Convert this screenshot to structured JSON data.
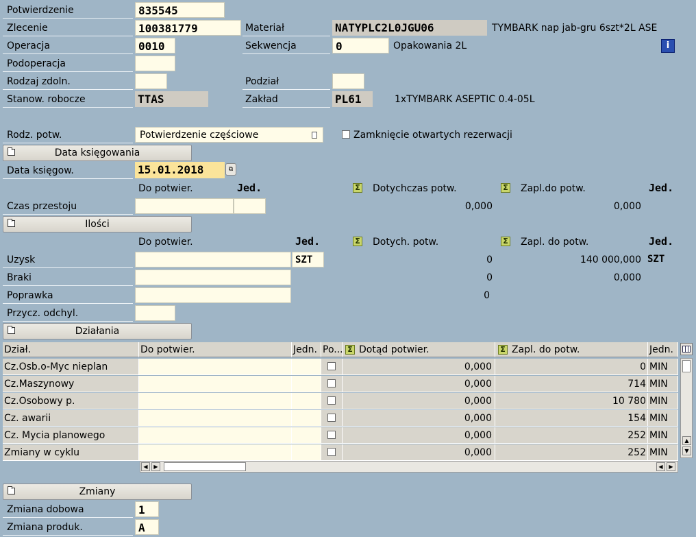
{
  "header": {
    "potwierdzenie_label": "Potwierdzenie",
    "potwierdzenie_value": "835545",
    "zlecenie_label": "Zlecenie",
    "zlecenie_value": "100381779",
    "material_label": "Materiał",
    "material_value": "NATYPLC2L0JGU06",
    "material_desc": "TYMBARK nap jab-gru 6szt*2L ASE",
    "operacja_label": "Operacja",
    "operacja_value": "0010",
    "sekwencja_label": "Sekwencja",
    "sekwencja_value": "0",
    "sekwencja_desc": "Opakowania 2L",
    "podoperacja_label": "Podoperacja",
    "rodzaj_label": "Rodzaj zdoln.",
    "podzial_label": "Podział",
    "stanow_label": "Stanow. robocze",
    "stanow_value": "TTAS",
    "zaklad_label": "Zakład",
    "zaklad_value": "PL61",
    "zaklad_desc": "1xTYMBARK ASEPTIC 0.4-05L",
    "info_icon": "i"
  },
  "rodz": {
    "label": "Rodz. potw.",
    "value": "Potwierdzenie częściowe",
    "zamkniecie_label": "Zamknięcie otwartych rezerwacji"
  },
  "data_ksieg": {
    "section_button": "Data księgowania",
    "label": "Data księgow.",
    "value": "15.01.2018",
    "col_do_potwier": "Do potwier.",
    "col_jed": "Jed.",
    "col_dotychczas": "Dotychczas potw.",
    "col_zapl": "Zapl.do potw.",
    "col_jed2": "Jed.",
    "czas_label": "Czas przestoju",
    "czas_dotychczas": "0,000",
    "czas_zapl": "0,000"
  },
  "ilosci": {
    "section_button": "Ilości",
    "col_do_potwier": "Do potwier.",
    "col_jed": "Jed.",
    "col_dotych": "Dotych. potw.",
    "col_zapl": "Zapl. do potw.",
    "col_jed2": "Jed.",
    "uzysk_label": "Uzysk",
    "uzysk_unit": "SZT",
    "uzysk_dotych": "0",
    "uzysk_zapl": "140 000,000",
    "uzysk_unit2": "SZT",
    "braki_label": "Braki",
    "braki_dotych": "0",
    "braki_zapl": "0,000",
    "poprawka_label": "Poprawka",
    "poprawka_dotych": "0",
    "przycz_label": "Przycz. odchyl."
  },
  "dzialania": {
    "section_button": "Działania",
    "columns": [
      "Dział.",
      "Do potwier.",
      "Jedn.",
      "Po...",
      "Dotąd potwier.",
      "Zapl. do potw.",
      "Jedn."
    ],
    "rows": [
      {
        "name": "Cz.Osb.o-Myc nieplan",
        "dotad": "0,000",
        "zapl": "0",
        "unit": "MIN"
      },
      {
        "name": "Cz.Maszynowy",
        "dotad": "0,000",
        "zapl": "714",
        "unit": "MIN"
      },
      {
        "name": "Cz.Osobowy p.",
        "dotad": "0,000",
        "zapl": "10 780",
        "unit": "MIN"
      },
      {
        "name": "Cz. awarii",
        "dotad": "0,000",
        "zapl": "154",
        "unit": "MIN"
      },
      {
        "name": "Cz. Mycia planowego",
        "dotad": "0,000",
        "zapl": "252",
        "unit": "MIN"
      },
      {
        "name": "Zmiany w cyklu",
        "dotad": "0,000",
        "zapl": "252",
        "unit": "MIN"
      }
    ]
  },
  "zmiany": {
    "section_button": "Zmiany",
    "dobowa_label": "Zmiana dobowa",
    "dobowa_value": "1",
    "produk_label": "Zmiana produk.",
    "produk_value": "A"
  },
  "icons": {
    "sigma": "Σ",
    "calendar": "date-picker-icon",
    "dropdown": "dropdown-icon"
  }
}
